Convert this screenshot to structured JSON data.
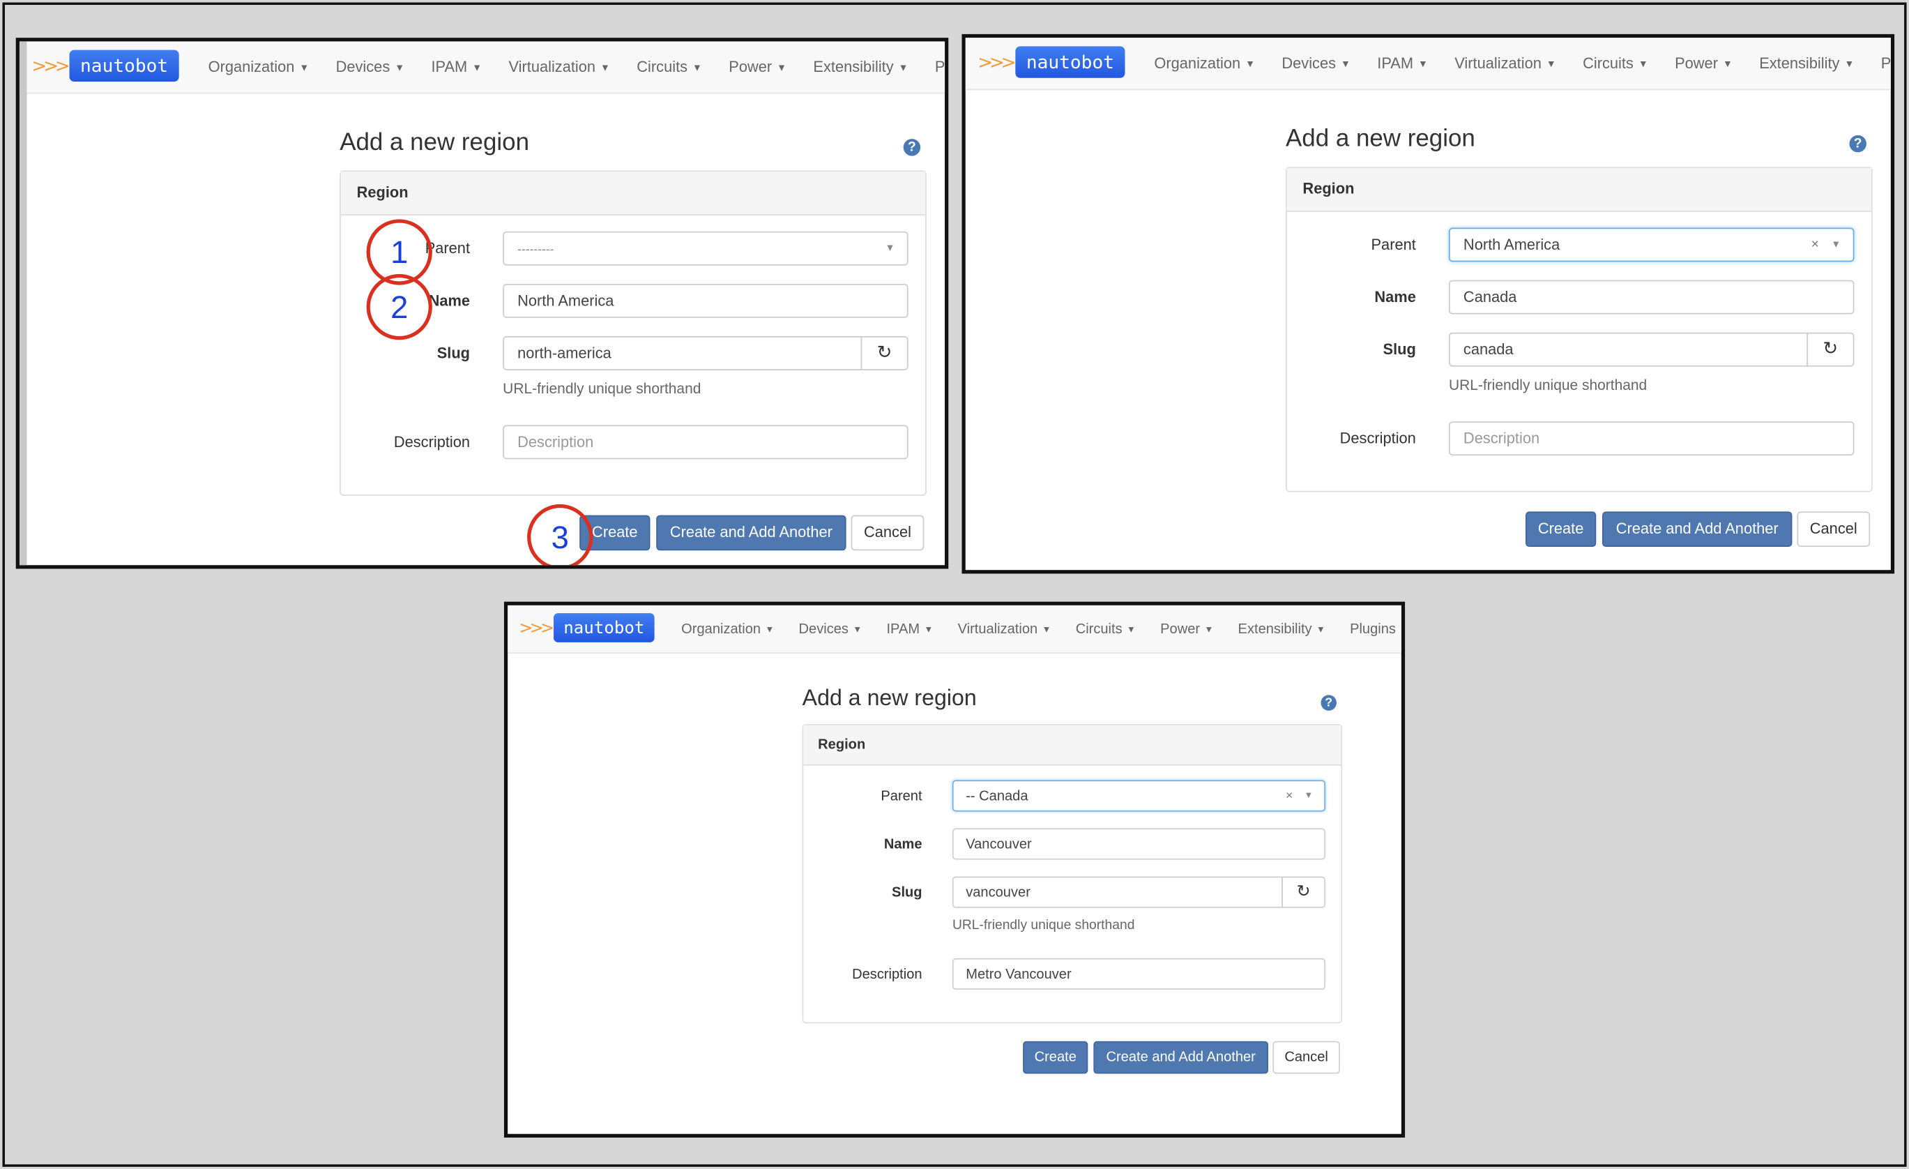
{
  "nav": {
    "logo": "nautobot",
    "items": [
      "Organization",
      "Devices",
      "IPAM",
      "Virtualization",
      "Circuits",
      "Power",
      "Extensibility",
      "Plugins"
    ]
  },
  "colors": {
    "primary_button": "#4f78b0",
    "annotation_circle": "#d9301f",
    "annotation_number": "#1a3fe0",
    "logo": "#2f6ae8"
  },
  "panels": [
    {
      "title": "Add a new region",
      "section": "Region",
      "labels": {
        "parent": "Parent",
        "name": "Name",
        "slug": "Slug",
        "description": "Description"
      },
      "parent": {
        "value": "---------",
        "placeholder_style": true,
        "clearable": false
      },
      "name": "North America",
      "slug": "north-america",
      "slug_help": "URL-friendly unique shorthand",
      "description": {
        "value": "",
        "placeholder": "Description"
      },
      "buttons": {
        "create": "Create",
        "create_another": "Create and Add Another",
        "cancel": "Cancel"
      },
      "annotations": [
        "1",
        "2",
        "3"
      ]
    },
    {
      "title": "Add a new region",
      "section": "Region",
      "labels": {
        "parent": "Parent",
        "name": "Name",
        "slug": "Slug",
        "description": "Description"
      },
      "parent": {
        "value": "North America",
        "clearable": true
      },
      "name": "Canada",
      "slug": "canada",
      "slug_help": "URL-friendly unique shorthand",
      "description": {
        "value": "",
        "placeholder": "Description"
      },
      "buttons": {
        "create": "Create",
        "create_another": "Create and Add Another",
        "cancel": "Cancel"
      }
    },
    {
      "title": "Add a new region",
      "section": "Region",
      "labels": {
        "parent": "Parent",
        "name": "Name",
        "slug": "Slug",
        "description": "Description"
      },
      "parent": {
        "value": "-- Canada",
        "clearable": true
      },
      "name": "Vancouver",
      "slug": "vancouver",
      "slug_help": "URL-friendly unique shorthand",
      "description": {
        "value": "Metro Vancouver",
        "placeholder": "Description"
      },
      "buttons": {
        "create": "Create",
        "create_another": "Create and Add Another",
        "cancel": "Cancel"
      }
    }
  ]
}
